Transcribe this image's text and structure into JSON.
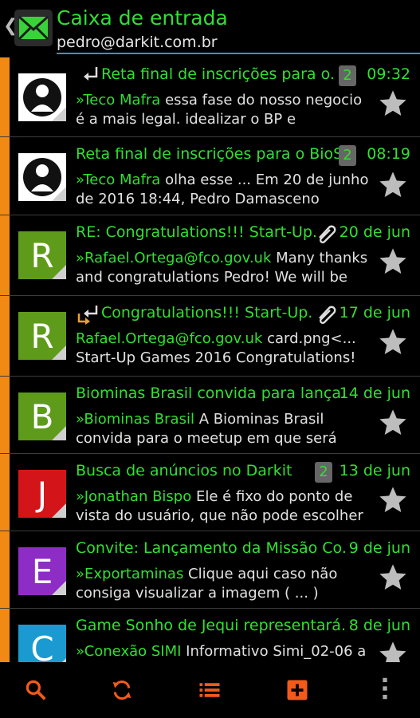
{
  "header": {
    "title": "Caixa de entrada",
    "account": "pedro@darkit.com.br"
  },
  "colors": {
    "accent_green": "#31e031",
    "flag_orange": "#f08a14",
    "toolbar_orange": "#f25a1a",
    "underline_blue": "#3a8fd6"
  },
  "messages": [
    {
      "subject": "Reta final de inscrições para o.",
      "date": "09:32",
      "count": "2",
      "sender": "»Teco Mafra",
      "preview": " essa fase do nosso negocio é a mais legal. idealizar o BP e",
      "avatar": "photo",
      "icons": [
        "reply-icon"
      ]
    },
    {
      "subject": "Reta final de inscrições para o BioS.",
      "date": "08:19",
      "count": "2",
      "sender": "»Teco Mafra",
      "preview": " olha esse ... Em 20 de junho de 2016 18:44, Pedro Damasceno",
      "avatar": "photo",
      "icons": []
    },
    {
      "subject": "RE: Congratulations!!! Start-Up.",
      "date": "20 de jun",
      "sender": "»Rafael.Ortega@fco.gov.uk",
      "preview": " Many thanks and congratulations Pedro! We will be",
      "avatar_letter": "R",
      "avatar_color": "#5e9b1a",
      "icons": [
        "paperclip-icon"
      ]
    },
    {
      "subject": "Congratulations!!! Start-Up.",
      "date": "17 de jun",
      "sender": "Rafael.Ortega@fco.gov.uk",
      "preview": " card.png<... Start-Up Games 2016 Congratulations!",
      "avatar_letter": "R",
      "avatar_color": "#5e9b1a",
      "icons": [
        "reply-forward-icon",
        "paperclip-icon"
      ]
    },
    {
      "subject": "Biominas Brasil convida para lança.",
      "date": "14 de jun",
      "sender": "»Biominas Brasil",
      "preview": " A Biominas Brasil convida para o meetup em que será",
      "avatar_letter": "B",
      "avatar_color": "#5e9b1a",
      "icons": []
    },
    {
      "subject": "Busca de anúncios no Darkit",
      "date": "13 de jun",
      "count": "2",
      "sender": "»Jonathan Bispo",
      "preview": " Ele é fixo do ponto de vista do usuário, que não pode escolher",
      "avatar_letter": "J",
      "avatar_color": "#d3151a",
      "icons": []
    },
    {
      "subject": "Convite: Lançamento da Missão Co.",
      "date": "9 de jun",
      "sender": "»Exportaminas",
      "preview": " Clique aqui caso não consiga visualizar a imagem ( ... )",
      "avatar_letter": "E",
      "avatar_color": "#8e2cc6",
      "icons": []
    },
    {
      "subject": "Game Sonho de Jequi representará.",
      "date": "8 de jun",
      "sender": "»Conexão SIMI",
      "preview": " Informativo Simi_02-06 a",
      "avatar_letter": "C",
      "avatar_color": "#1a9ad1",
      "icons": []
    }
  ],
  "toolbar": [
    "search-icon",
    "refresh-icon",
    "list-icon",
    "compose-icon",
    "overflow-menu-icon"
  ]
}
